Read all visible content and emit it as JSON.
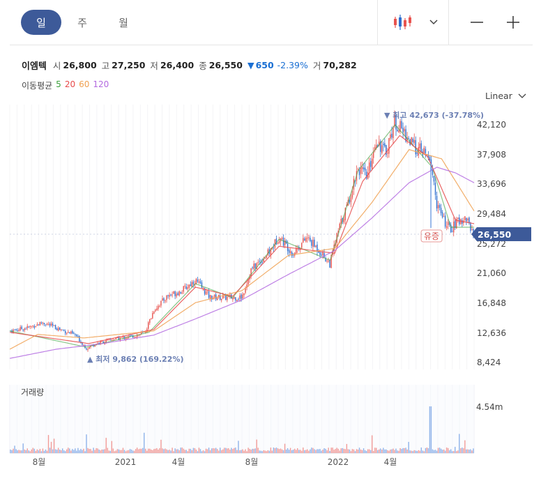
{
  "toolbar": {
    "periods": [
      {
        "label": "일",
        "active": true
      },
      {
        "label": "주",
        "active": false
      },
      {
        "label": "월",
        "active": false
      }
    ]
  },
  "stock": {
    "name": "이엠텍",
    "open_label": "시",
    "open": "26,800",
    "high_label": "고",
    "high": "27,250",
    "low_label": "저",
    "low": "26,400",
    "close_label": "종",
    "close": "26,550",
    "change_symbol": "▼",
    "change": "650",
    "change_pct": "-2.39%",
    "volume_label": "거",
    "volume": "70,282"
  },
  "ma": {
    "label": "이동평균",
    "periods": [
      "5",
      "20",
      "60",
      "120"
    ],
    "colors": [
      "#3aa03a",
      "#e84a4a",
      "#f0a050",
      "#b36ae0"
    ]
  },
  "scale_label": "Linear",
  "colors": {
    "up": "#e8534f",
    "down": "#2f6fcf",
    "accent": "#3d5a99",
    "badge": "#3d5a99",
    "annotation": "#6b7fb3"
  },
  "chart_data": {
    "type": "candlestick",
    "price_axis": {
      "ticks": [
        "42,120",
        "37,908",
        "33,696",
        "29,484",
        "25,272",
        "21,060",
        "16,848",
        "12,636",
        "8,424"
      ],
      "range": [
        8424,
        42120
      ]
    },
    "current_price_label": "26,550",
    "annotations": {
      "high": "▼ 최고 42,673 (-37.78%)",
      "low": "▲ 최저 9,862 (169.22%)",
      "event": "유증"
    },
    "volume": {
      "label": "거래량",
      "max_label": "4.54m",
      "max": 4540000
    },
    "x_ticks": [
      "8월",
      "2021",
      "4월",
      "8월",
      "2022",
      "4월"
    ],
    "price_anchors": [
      [
        0,
        12800
      ],
      [
        0.04,
        13300
      ],
      [
        0.07,
        14000
      ],
      [
        0.1,
        13200
      ],
      [
        0.14,
        12200
      ],
      [
        0.165,
        10300
      ],
      [
        0.18,
        10900
      ],
      [
        0.22,
        11600
      ],
      [
        0.26,
        12000
      ],
      [
        0.29,
        12500
      ],
      [
        0.31,
        15800
      ],
      [
        0.34,
        17800
      ],
      [
        0.37,
        18500
      ],
      [
        0.4,
        20000
      ],
      [
        0.43,
        17600
      ],
      [
        0.48,
        17500
      ],
      [
        0.5,
        17600
      ],
      [
        0.52,
        21500
      ],
      [
        0.56,
        24000
      ],
      [
        0.58,
        26200
      ],
      [
        0.61,
        23800
      ],
      [
        0.64,
        26000
      ],
      [
        0.67,
        24000
      ],
      [
        0.69,
        22300
      ],
      [
        0.71,
        27400
      ],
      [
        0.73,
        31000
      ],
      [
        0.75,
        36000
      ],
      [
        0.77,
        34500
      ],
      [
        0.79,
        40000
      ],
      [
        0.81,
        38000
      ],
      [
        0.83,
        42500
      ],
      [
        0.85,
        41000
      ],
      [
        0.87,
        39000
      ],
      [
        0.895,
        38000
      ],
      [
        0.91,
        36000
      ],
      [
        0.92,
        31000
      ],
      [
        0.935,
        28500
      ],
      [
        0.95,
        27200
      ],
      [
        0.97,
        28500
      ],
      [
        0.985,
        28800
      ],
      [
        1.0,
        26550
      ]
    ],
    "ma_anchors": {
      "ma5": [
        [
          0,
          12800
        ],
        [
          0.165,
          10500
        ],
        [
          0.3,
          12600
        ],
        [
          0.4,
          19500
        ],
        [
          0.48,
          17500
        ],
        [
          0.58,
          25800
        ],
        [
          0.69,
          22800
        ],
        [
          0.75,
          35500
        ],
        [
          0.83,
          42000
        ],
        [
          0.91,
          36000
        ],
        [
          0.95,
          27500
        ],
        [
          1.0,
          27500
        ]
      ],
      "ma20": [
        [
          0,
          12600
        ],
        [
          0.17,
          11000
        ],
        [
          0.31,
          13000
        ],
        [
          0.4,
          19000
        ],
        [
          0.48,
          17700
        ],
        [
          0.58,
          24800
        ],
        [
          0.7,
          23800
        ],
        [
          0.76,
          34000
        ],
        [
          0.84,
          40500
        ],
        [
          0.9,
          37500
        ],
        [
          0.96,
          28500
        ],
        [
          1.0,
          28000
        ]
      ],
      "ma60": [
        [
          0,
          10200
        ],
        [
          0.06,
          12300
        ],
        [
          0.16,
          11800
        ],
        [
          0.31,
          12800
        ],
        [
          0.4,
          16800
        ],
        [
          0.5,
          18500
        ],
        [
          0.6,
          23500
        ],
        [
          0.7,
          24500
        ],
        [
          0.78,
          31000
        ],
        [
          0.86,
          38500
        ],
        [
          0.93,
          37200
        ],
        [
          1.0,
          29800
        ]
      ],
      "ma120": [
        [
          0,
          8900
        ],
        [
          0.1,
          10200
        ],
        [
          0.2,
          11000
        ],
        [
          0.31,
          12200
        ],
        [
          0.4,
          14500
        ],
        [
          0.5,
          17200
        ],
        [
          0.6,
          20800
        ],
        [
          0.7,
          24200
        ],
        [
          0.78,
          28800
        ],
        [
          0.86,
          33800
        ],
        [
          0.92,
          36000
        ],
        [
          0.96,
          35200
        ],
        [
          1.0,
          33800
        ]
      ]
    }
  }
}
